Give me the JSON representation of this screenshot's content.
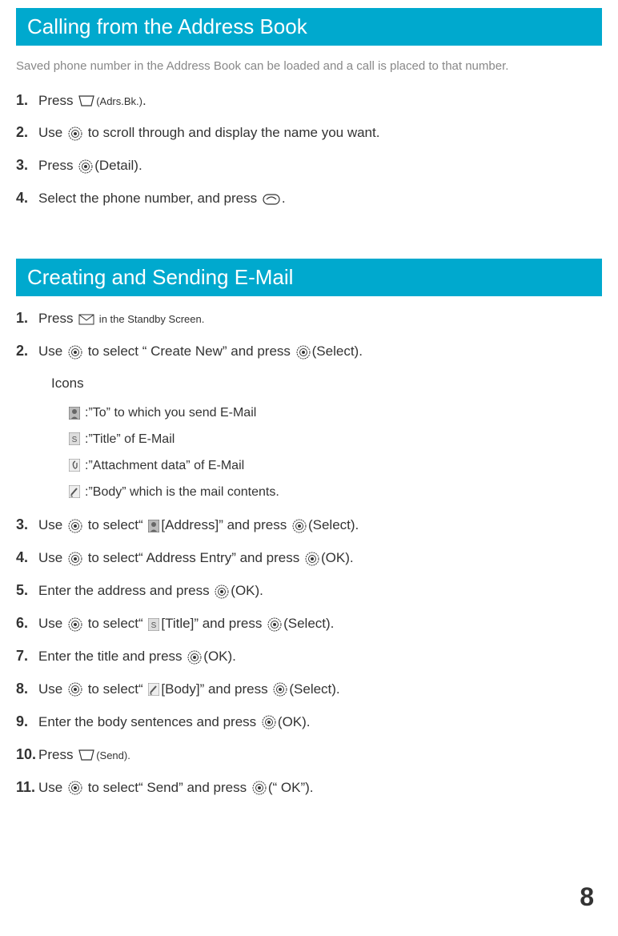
{
  "section1": {
    "title": "Calling from the Address Book",
    "intro": "Saved phone number in the Address Book can be loaded and a call is placed to that number.",
    "steps": [
      {
        "num": "1.",
        "parts": [
          "Press ",
          "ICON_SOFTKEY",
          "(Adrs.Bk.)",
          "."
        ]
      },
      {
        "num": "2.",
        "parts": [
          "Use ",
          "ICON_NAV",
          " to scroll through and display the name you want."
        ]
      },
      {
        "num": "3.",
        "parts": [
          "Press ",
          "ICON_NAV",
          "(Detail)."
        ]
      },
      {
        "num": "4.",
        "parts": [
          "Select the phone number, and press ",
          "ICON_PHONE",
          "."
        ]
      }
    ]
  },
  "section2": {
    "title": "Creating and Sending E-Mail",
    "steps_top": [
      {
        "num": "1.",
        "parts": [
          "Press ",
          "ICON_MAIL",
          " in the Standby Screen."
        ],
        "small_after": 1
      },
      {
        "num": "2.",
        "parts": [
          "Use ",
          "ICON_NAV",
          " to select “ Create New” and press ",
          "ICON_NAV",
          "(Select)."
        ]
      }
    ],
    "icons_heading": "Icons",
    "icon_descs": [
      {
        "icon": "ICON_TO",
        "text": ":”To” to which you send E-Mail"
      },
      {
        "icon": "ICON_TITLE",
        "text": ":”Title” of E-Mail"
      },
      {
        "icon": "ICON_ATTACH",
        "text": ":”Attachment data” of E-Mail"
      },
      {
        "icon": "ICON_BODY",
        "text": ":”Body” which is the mail contents."
      }
    ],
    "steps_bottom": [
      {
        "num": "3.",
        "parts": [
          "Use ",
          "ICON_NAV",
          " to select“ ",
          "ICON_TO",
          "[Address]” and press ",
          "ICON_NAV",
          "(Select)."
        ]
      },
      {
        "num": "4.",
        "parts": [
          "Use ",
          "ICON_NAV",
          " to select“ Address Entry” and press ",
          "ICON_NAV",
          "(OK)."
        ]
      },
      {
        "num": "5.",
        "parts": [
          "Enter the address and press ",
          "ICON_NAV",
          "(OK)."
        ]
      },
      {
        "num": "6.",
        "parts": [
          "Use ",
          "ICON_NAV",
          " to select“ ",
          "ICON_TITLE",
          "[Title]” and press ",
          "ICON_NAV",
          "(Select)."
        ]
      },
      {
        "num": "7.",
        "parts": [
          "Enter the title and press ",
          "ICON_NAV",
          "(OK)."
        ]
      },
      {
        "num": "8.",
        "parts": [
          "Use ",
          "ICON_NAV",
          " to select“ ",
          "ICON_BODY",
          "[Body]” and press ",
          "ICON_NAV",
          "(Select)."
        ]
      },
      {
        "num": "9.",
        "parts": [
          "Enter the body sentences and press ",
          "ICON_NAV",
          "(OK)."
        ]
      },
      {
        "num": "10.",
        "parts": [
          " Press ",
          "ICON_SOFTKEY",
          "(Send)",
          "."
        ],
        "small_after": 2
      },
      {
        "num": "11.",
        "parts": [
          " Use ",
          "ICON_NAV",
          " to select“ Send” and press ",
          "ICON_NAV",
          "(“ OK”)."
        ]
      }
    ]
  },
  "page_number": "8"
}
